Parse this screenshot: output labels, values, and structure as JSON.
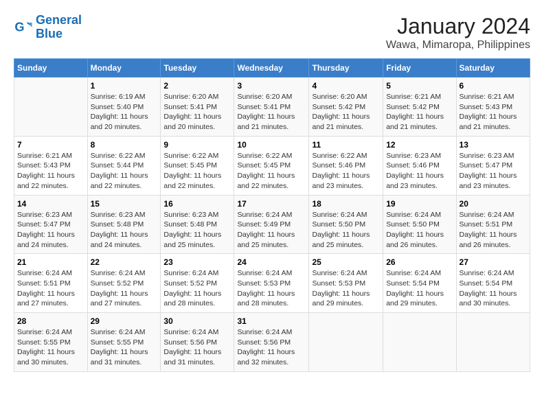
{
  "logo": {
    "line1": "General",
    "line2": "Blue"
  },
  "title": "January 2024",
  "subtitle": "Wawa, Mimaropa, Philippines",
  "weekdays": [
    "Sunday",
    "Monday",
    "Tuesday",
    "Wednesday",
    "Thursday",
    "Friday",
    "Saturday"
  ],
  "weeks": [
    [
      {
        "day": "",
        "info": ""
      },
      {
        "day": "1",
        "info": "Sunrise: 6:19 AM\nSunset: 5:40 PM\nDaylight: 11 hours\nand 20 minutes."
      },
      {
        "day": "2",
        "info": "Sunrise: 6:20 AM\nSunset: 5:41 PM\nDaylight: 11 hours\nand 20 minutes."
      },
      {
        "day": "3",
        "info": "Sunrise: 6:20 AM\nSunset: 5:41 PM\nDaylight: 11 hours\nand 21 minutes."
      },
      {
        "day": "4",
        "info": "Sunrise: 6:20 AM\nSunset: 5:42 PM\nDaylight: 11 hours\nand 21 minutes."
      },
      {
        "day": "5",
        "info": "Sunrise: 6:21 AM\nSunset: 5:42 PM\nDaylight: 11 hours\nand 21 minutes."
      },
      {
        "day": "6",
        "info": "Sunrise: 6:21 AM\nSunset: 5:43 PM\nDaylight: 11 hours\nand 21 minutes."
      }
    ],
    [
      {
        "day": "7",
        "info": "Sunrise: 6:21 AM\nSunset: 5:43 PM\nDaylight: 11 hours\nand 22 minutes."
      },
      {
        "day": "8",
        "info": "Sunrise: 6:22 AM\nSunset: 5:44 PM\nDaylight: 11 hours\nand 22 minutes."
      },
      {
        "day": "9",
        "info": "Sunrise: 6:22 AM\nSunset: 5:45 PM\nDaylight: 11 hours\nand 22 minutes."
      },
      {
        "day": "10",
        "info": "Sunrise: 6:22 AM\nSunset: 5:45 PM\nDaylight: 11 hours\nand 22 minutes."
      },
      {
        "day": "11",
        "info": "Sunrise: 6:22 AM\nSunset: 5:46 PM\nDaylight: 11 hours\nand 23 minutes."
      },
      {
        "day": "12",
        "info": "Sunrise: 6:23 AM\nSunset: 5:46 PM\nDaylight: 11 hours\nand 23 minutes."
      },
      {
        "day": "13",
        "info": "Sunrise: 6:23 AM\nSunset: 5:47 PM\nDaylight: 11 hours\nand 23 minutes."
      }
    ],
    [
      {
        "day": "14",
        "info": "Sunrise: 6:23 AM\nSunset: 5:47 PM\nDaylight: 11 hours\nand 24 minutes."
      },
      {
        "day": "15",
        "info": "Sunrise: 6:23 AM\nSunset: 5:48 PM\nDaylight: 11 hours\nand 24 minutes."
      },
      {
        "day": "16",
        "info": "Sunrise: 6:23 AM\nSunset: 5:48 PM\nDaylight: 11 hours\nand 25 minutes."
      },
      {
        "day": "17",
        "info": "Sunrise: 6:24 AM\nSunset: 5:49 PM\nDaylight: 11 hours\nand 25 minutes."
      },
      {
        "day": "18",
        "info": "Sunrise: 6:24 AM\nSunset: 5:50 PM\nDaylight: 11 hours\nand 25 minutes."
      },
      {
        "day": "19",
        "info": "Sunrise: 6:24 AM\nSunset: 5:50 PM\nDaylight: 11 hours\nand 26 minutes."
      },
      {
        "day": "20",
        "info": "Sunrise: 6:24 AM\nSunset: 5:51 PM\nDaylight: 11 hours\nand 26 minutes."
      }
    ],
    [
      {
        "day": "21",
        "info": "Sunrise: 6:24 AM\nSunset: 5:51 PM\nDaylight: 11 hours\nand 27 minutes."
      },
      {
        "day": "22",
        "info": "Sunrise: 6:24 AM\nSunset: 5:52 PM\nDaylight: 11 hours\nand 27 minutes."
      },
      {
        "day": "23",
        "info": "Sunrise: 6:24 AM\nSunset: 5:52 PM\nDaylight: 11 hours\nand 28 minutes."
      },
      {
        "day": "24",
        "info": "Sunrise: 6:24 AM\nSunset: 5:53 PM\nDaylight: 11 hours\nand 28 minutes."
      },
      {
        "day": "25",
        "info": "Sunrise: 6:24 AM\nSunset: 5:53 PM\nDaylight: 11 hours\nand 29 minutes."
      },
      {
        "day": "26",
        "info": "Sunrise: 6:24 AM\nSunset: 5:54 PM\nDaylight: 11 hours\nand 29 minutes."
      },
      {
        "day": "27",
        "info": "Sunrise: 6:24 AM\nSunset: 5:54 PM\nDaylight: 11 hours\nand 30 minutes."
      }
    ],
    [
      {
        "day": "28",
        "info": "Sunrise: 6:24 AM\nSunset: 5:55 PM\nDaylight: 11 hours\nand 30 minutes."
      },
      {
        "day": "29",
        "info": "Sunrise: 6:24 AM\nSunset: 5:55 PM\nDaylight: 11 hours\nand 31 minutes."
      },
      {
        "day": "30",
        "info": "Sunrise: 6:24 AM\nSunset: 5:56 PM\nDaylight: 11 hours\nand 31 minutes."
      },
      {
        "day": "31",
        "info": "Sunrise: 6:24 AM\nSunset: 5:56 PM\nDaylight: 11 hours\nand 32 minutes."
      },
      {
        "day": "",
        "info": ""
      },
      {
        "day": "",
        "info": ""
      },
      {
        "day": "",
        "info": ""
      }
    ]
  ]
}
